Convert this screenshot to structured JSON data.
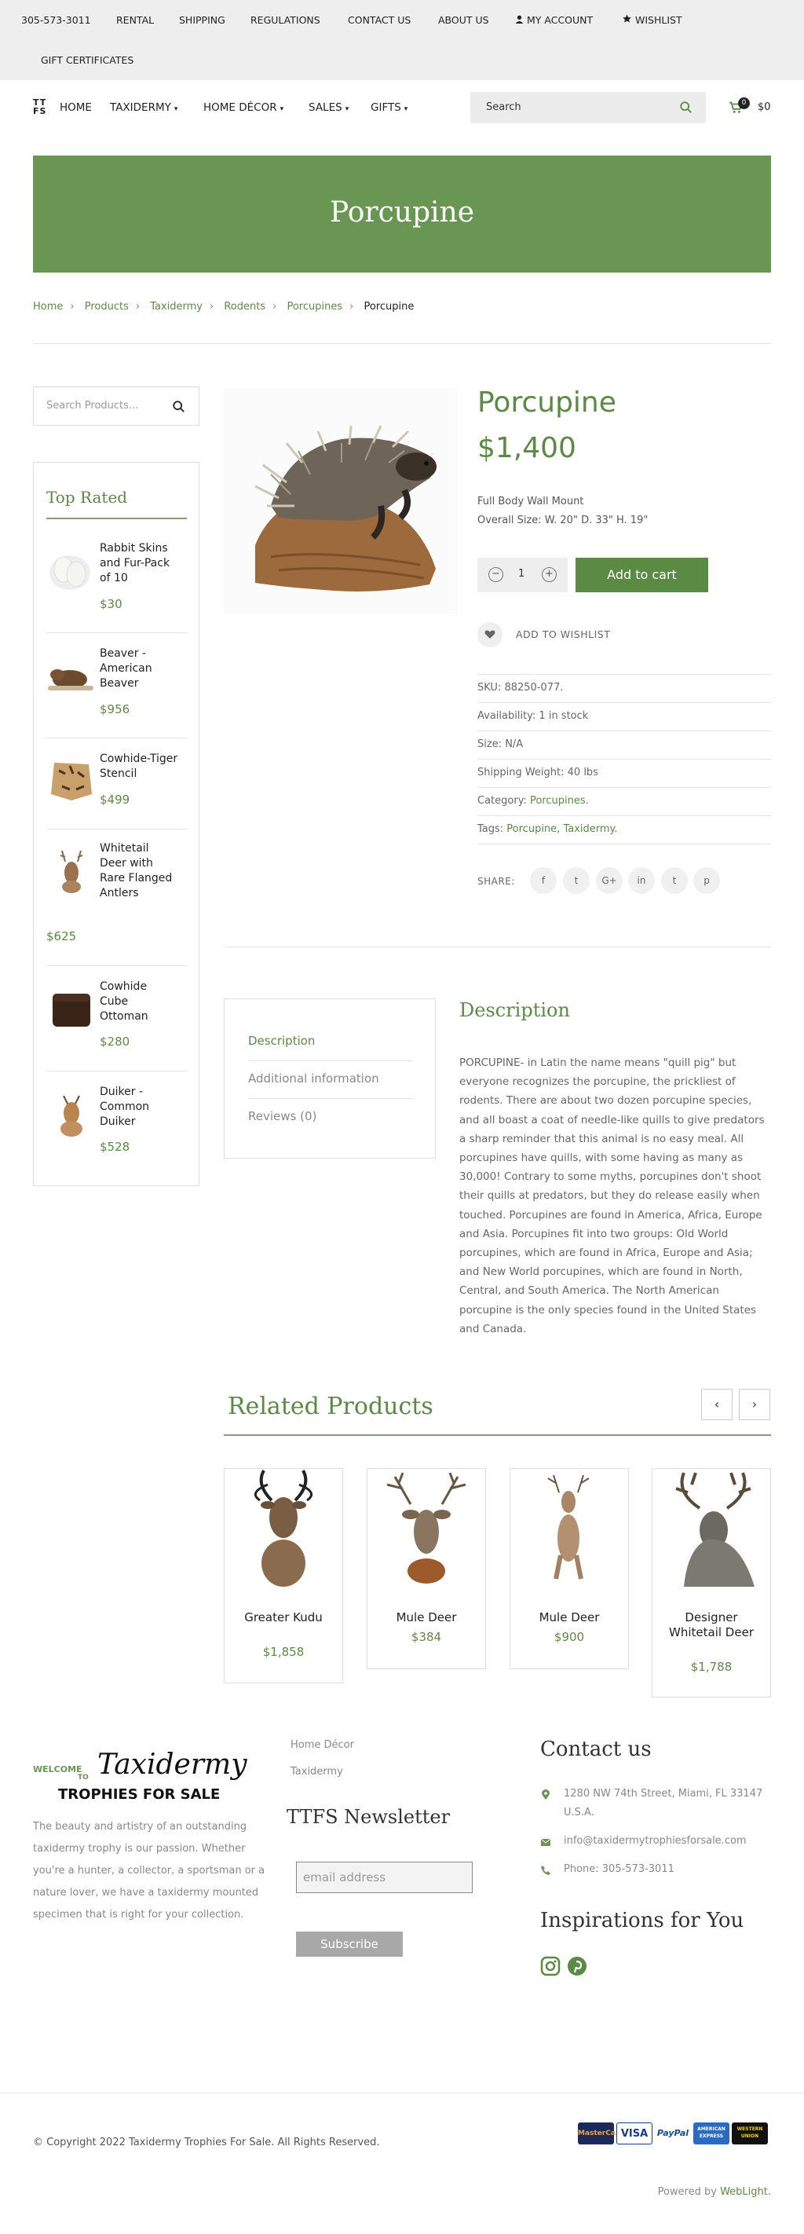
{
  "topbar": {
    "phone": "305-573-3011",
    "links": [
      "RENTAL",
      "SHIPPING",
      "REGULATIONS",
      "CONTACT US",
      "ABOUT US"
    ],
    "my_account": "MY ACCOUNT",
    "wishlist": "WISHLIST",
    "gift_certificates": "GIFT CERTIFICATES"
  },
  "header": {
    "logo_top": "TT",
    "logo_bottom": "FS",
    "nav": [
      {
        "label": "HOME",
        "dropdown": false
      },
      {
        "label": "TAXIDERMY",
        "dropdown": true
      },
      {
        "label": "HOME DÉCOR",
        "dropdown": true
      },
      {
        "label": "SALES",
        "dropdown": true
      },
      {
        "label": "GIFTS",
        "dropdown": true
      }
    ],
    "search_placeholder": "Search",
    "cart_count": "0",
    "cart_total": "$0"
  },
  "banner": {
    "title": "Porcupine"
  },
  "breadcrumb": [
    "Home",
    "Products",
    "Taxidermy",
    "Rodents",
    "Porcupines",
    "Porcupine"
  ],
  "sidebar": {
    "search_placeholder": "Search Products...",
    "top_rated_title": "Top Rated",
    "items": [
      {
        "name": "Rabbit Skins and Fur-Pack of 10",
        "price": "$30"
      },
      {
        "name": "Beaver - American Beaver",
        "price": "$956"
      },
      {
        "name": "Cowhide-Tiger Stencil",
        "price": "$499"
      },
      {
        "name": "Whitetail Deer with Rare Flanged Antlers",
        "price": "$625"
      },
      {
        "name": "Cowhide Cube Ottoman",
        "price": "$280"
      },
      {
        "name": "Duiker - Common Duiker",
        "price": "$528"
      }
    ]
  },
  "product": {
    "title": "Porcupine",
    "price": "$1,400",
    "short_desc_1": "Full Body Wall Mount",
    "short_desc_2": "Overall Size: W. 20\" D. 33\" H. 19\"",
    "quantity": "1",
    "add_to_cart": "Add to cart",
    "add_to_wishlist": "ADD TO WISHLIST",
    "sku": "SKU: 88250-077.",
    "availability": "Availability: 1 in stock",
    "size": "Size: N/A",
    "shipping_weight": "Shipping Weight: 40 lbs",
    "category_label": "Category: ",
    "category": "Porcupines.",
    "tags_label": "Tags: ",
    "tag_1": "Porcupine",
    "tag_2": "Taxidermy.",
    "share": "SHARE:",
    "social": [
      "f",
      "t",
      "G+",
      "in",
      "t",
      "p"
    ]
  },
  "tabs": {
    "items": [
      "Description",
      "Additional information",
      "Reviews (0)"
    ],
    "description_title": "Description",
    "description_text": "PORCUPINE- in Latin the name means \"quill pig\" but everyone recognizes the porcupine, the prickliest of rodents. There are about two dozen porcupine species, and all boast a coat of needle-like quills to give predators a sharp reminder that this animal is no easy meal. All porcupines have quills, with some having as many as 30,000! Contrary to some myths, porcupines don't shoot their quills at predators, but they do release easily when touched. Porcupines are found in America, Africa, Europe and Asia. Porcupines fit into two groups: Old World porcupines, which are found in Africa, Europe and Asia; and New World porcupines, which are found in North, Central, and South America. The North American porcupine is the only species found in the United States and Canada."
  },
  "related": {
    "title": "Related Products",
    "items": [
      {
        "name": "Greater Kudu",
        "price": "$1,858"
      },
      {
        "name": "Mule Deer",
        "price": "$384"
      },
      {
        "name": "Mule Deer",
        "price": "$900"
      },
      {
        "name": "Designer Whitetail Deer",
        "price": "$1,788"
      }
    ]
  },
  "footer": {
    "logo_welcome": "WELCOME",
    "logo_to": "TO",
    "logo_main": "Taxidermy",
    "logo_sub": "TROPHIES FOR SALE",
    "about": "The beauty and artistry of an outstanding taxidermy trophy is our passion. Whether you're a hunter, a collector, a sportsman or a nature lover, we have a taxidermy mounted specimen that is right for your collection.",
    "links": [
      "Home Décor",
      "Taxidermy"
    ],
    "newsletter_title": "TTFS Newsletter",
    "email_placeholder": "email address",
    "subscribe": "Subscribe",
    "contact_title": "Contact us",
    "address": "1280 NW 74th Street, Miami, FL 33147 U.S.A.",
    "email": "info@taxidermytrophiesforsale.com",
    "phone": "Phone: 305-573-3011",
    "inspirations_title": "Inspirations for You",
    "copyright": "© Copyright 2022 Taxidermy Trophies For Sale. All Rights Reserved.",
    "payments": [
      "MasterCard",
      "VISA",
      "PayPal",
      "AMERICAN EXPRESS",
      "WESTERN UNION"
    ],
    "powered_by": "Powered by ",
    "powered_link": "WebLight."
  },
  "colors": {
    "brand_green": "#5b8a44",
    "banner_green": "#6a9654"
  }
}
